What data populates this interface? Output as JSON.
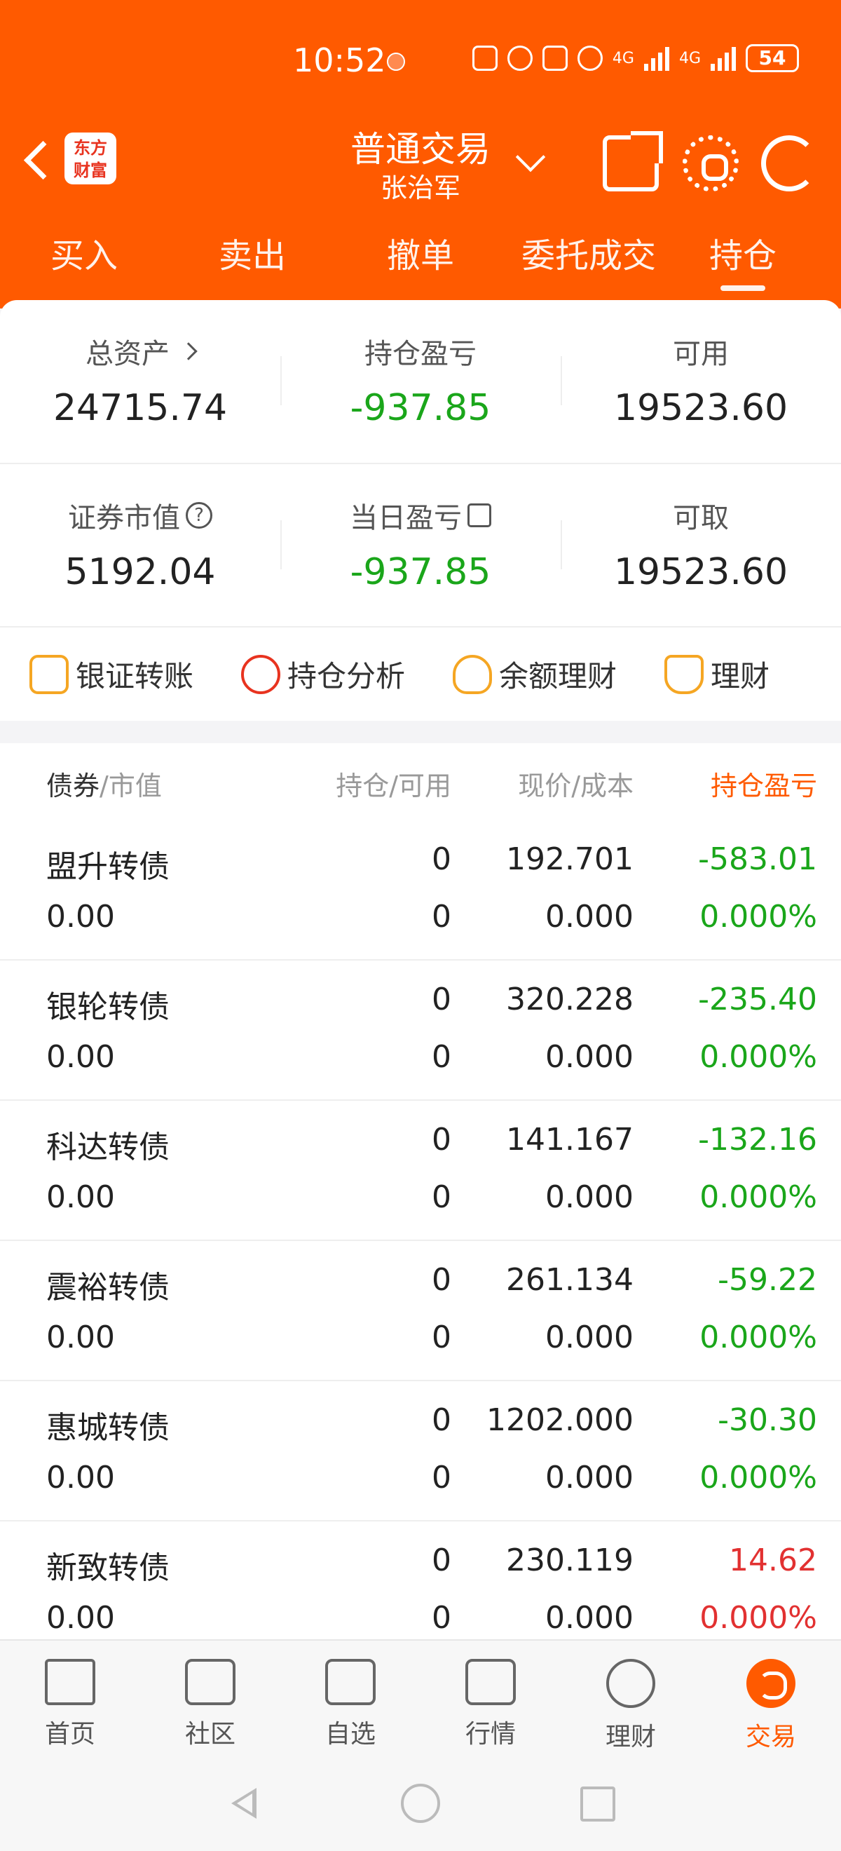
{
  "status_bar": {
    "time": "10:52",
    "battery": "54",
    "net1": "4G",
    "net2": "4G"
  },
  "nav": {
    "logo_line1": "东方",
    "logo_line2": "财富",
    "title": "普通交易",
    "subtitle": "张治军"
  },
  "tabs": [
    {
      "label": "买入"
    },
    {
      "label": "卖出"
    },
    {
      "label": "撤单"
    },
    {
      "label": "委托成交"
    },
    {
      "label": "持仓"
    }
  ],
  "summary": {
    "total_assets": {
      "label": "总资产",
      "value": "24715.74"
    },
    "position_pl": {
      "label": "持仓盈亏",
      "value": "-937.85"
    },
    "available": {
      "label": "可用",
      "value": "19523.60"
    },
    "market_value": {
      "label": "证券市值",
      "value": "5192.04"
    },
    "daily_pl": {
      "label": "当日盈亏",
      "value": "-937.85"
    },
    "withdrawable": {
      "label": "可取",
      "value": "19523.60"
    }
  },
  "quick_actions": [
    {
      "label": "银证转账"
    },
    {
      "label": "持仓分析"
    },
    {
      "label": "余额理财"
    },
    {
      "label": "理财"
    }
  ],
  "holdings": {
    "columns": {
      "col1_main": "债券",
      "col1_sub": "/市值",
      "col2": "持仓/可用",
      "col3": "现价/成本",
      "col4": "持仓盈亏"
    },
    "rows": [
      {
        "name": "盟升转债",
        "market_value": "0.00",
        "hold": "0",
        "avail": "0",
        "price": "192.701",
        "cost": "0.000",
        "pl": "-583.01",
        "pl_pct": "0.000%"
      },
      {
        "name": "银轮转债",
        "market_value": "0.00",
        "hold": "0",
        "avail": "0",
        "price": "320.228",
        "cost": "0.000",
        "pl": "-235.40",
        "pl_pct": "0.000%"
      },
      {
        "name": "科达转债",
        "market_value": "0.00",
        "hold": "0",
        "avail": "0",
        "price": "141.167",
        "cost": "0.000",
        "pl": "-132.16",
        "pl_pct": "0.000%"
      },
      {
        "name": "震裕转债",
        "market_value": "0.00",
        "hold": "0",
        "avail": "0",
        "price": "261.134",
        "cost": "0.000",
        "pl": "-59.22",
        "pl_pct": "0.000%"
      },
      {
        "name": "惠城转债",
        "market_value": "0.00",
        "hold": "0",
        "avail": "0",
        "price": "1202.000",
        "cost": "0.000",
        "pl": "-30.30",
        "pl_pct": "0.000%"
      },
      {
        "name": "新致转债",
        "market_value": "0.00",
        "hold": "0",
        "avail": "0",
        "price": "230.119",
        "cost": "0.000",
        "pl": "14.62",
        "pl_pct": "0.000%"
      }
    ]
  },
  "bottom_nav": [
    {
      "label": "首页"
    },
    {
      "label": "社区"
    },
    {
      "label": "自选"
    },
    {
      "label": "行情"
    },
    {
      "label": "理财"
    },
    {
      "label": "交易"
    }
  ],
  "colors": {
    "brand": "#ff5a00",
    "gain": "#e23131",
    "loss": "#1aa61a"
  }
}
